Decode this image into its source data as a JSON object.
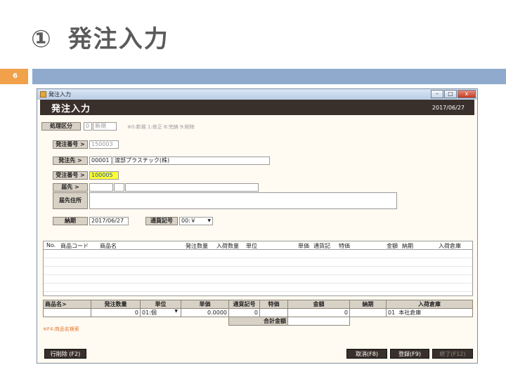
{
  "slide": {
    "title": "① 発注入力",
    "title_num": "①",
    "title_text": "発注入力",
    "page_number": "6"
  },
  "colors": {
    "accent_orange": "#f0a14a",
    "bar_blue": "#8faacc",
    "header_dark": "#3a302b",
    "highlight_yellow": "#ffff33"
  },
  "window": {
    "title": "発注入力",
    "buttons": [
      "–",
      "□",
      "x"
    ]
  },
  "header": {
    "title": "発注入力",
    "date": "2017/06/27"
  },
  "form": {
    "process_type": {
      "label": "処理区分",
      "value": "0",
      "status": "新規",
      "note": "※0:新規 1:修正 8:完納 9:削除"
    },
    "order_no": {
      "label": "発注番号 >",
      "value": "150003"
    },
    "supplier": {
      "label": "発注先 >",
      "code": "00001",
      "name": "渡部プラスチック(株)"
    },
    "received_order_no": {
      "label": "受注番号 >",
      "value": "100005"
    },
    "delivery_to": {
      "label": "届先 >"
    },
    "delivery_address": {
      "label": "届先住所"
    },
    "due_date": {
      "label": "納期",
      "value": "2017/06/27"
    },
    "currency": {
      "label": "通貨記号",
      "value": "00:￥"
    }
  },
  "grid": {
    "columns": [
      "No.",
      "商品コード",
      "商品名",
      "発注数量",
      "入荷数量",
      "単位",
      "単価",
      "通貨記",
      "特価",
      "金額",
      "納期",
      "入荷倉庫"
    ]
  },
  "entry": {
    "header": [
      "商品名>",
      "発注数量",
      "単位",
      "単価",
      "通貨記号",
      "特価",
      "金額",
      "納期",
      "入荷倉庫"
    ],
    "quantity": "0",
    "unit": "01:個",
    "unit_price": "0.0000",
    "currency_code": "0",
    "amount": "0",
    "warehouse_code": "01",
    "warehouse_name": "本社倉庫",
    "total_label": "合計金額",
    "hint": "※F4:商品名検索"
  },
  "footer": {
    "delete_row": "行削除 (F2)",
    "cancel": "取消(F8)",
    "register": "登録(F9)",
    "close": "終了(F12)"
  }
}
